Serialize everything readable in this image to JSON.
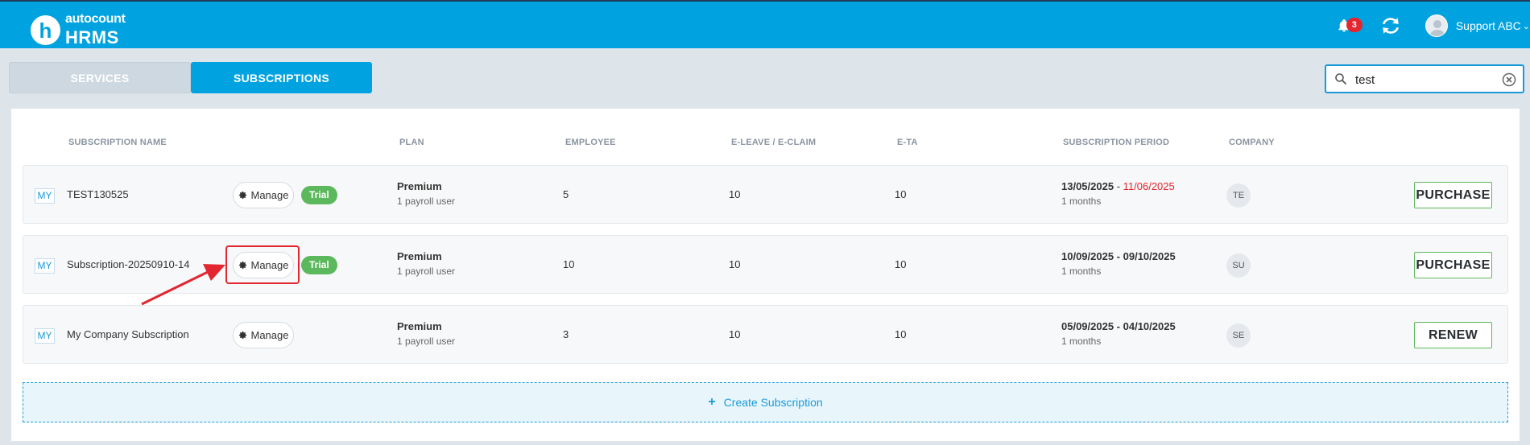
{
  "header": {
    "logo_letter": "h",
    "brand": "autocount",
    "product": "HRMS",
    "notification_count": "3",
    "user_name": "Support ABC",
    "bg_color": "#00a3e0"
  },
  "tabs": [
    {
      "label": "SERVICES",
      "active": false
    },
    {
      "label": "SUBSCRIPTIONS",
      "active": true
    }
  ],
  "search": {
    "value": "test",
    "placeholder": ""
  },
  "table": {
    "columns": {
      "name": "SUBSCRIPTION NAME",
      "plan": "PLAN",
      "employee": "EMPLOYEE",
      "eleave": "E-LEAVE / E-CLAIM",
      "eta": "E-TA",
      "period": "SUBSCRIPTION PERIOD",
      "company": "COMPANY"
    },
    "rows": [
      {
        "region": "MY",
        "name": "TEST130525",
        "manage_label": "Manage",
        "trial_label": "Trial",
        "plan": "Premium",
        "plan_sub": "1 payroll user",
        "employee": "5",
        "eleave": "10",
        "eta": "10",
        "period_start": "13/05/2025",
        "period_sep": " - ",
        "period_end": "11/06/2025",
        "period_length": "1 months",
        "company": "TE",
        "action": "PURCHASE"
      },
      {
        "region": "MY",
        "name": "Subscription-20250910-14",
        "manage_label": "Manage",
        "trial_label": "Trial",
        "plan": "Premium",
        "plan_sub": "1 payroll user",
        "employee": "10",
        "eleave": "10",
        "eta": "10",
        "period": "10/09/2025 - 09/10/2025",
        "period_length": "1 months",
        "company": "SU",
        "action": "PURCHASE"
      },
      {
        "region": "MY",
        "name": "My Company Subscription",
        "manage_label": "Manage",
        "plan": "Premium",
        "plan_sub": "1 payroll user",
        "employee": "3",
        "eleave": "10",
        "eta": "10",
        "period": "05/09/2025 - 04/10/2025",
        "period_length": "1 months",
        "company": "SE",
        "action": "RENEW"
      }
    ]
  },
  "create_label": "Create Subscription",
  "colors": {
    "accent": "#00a3e0",
    "trial": "#5cb85c",
    "expired": "#e3262f",
    "annotation": "#e3262f"
  }
}
